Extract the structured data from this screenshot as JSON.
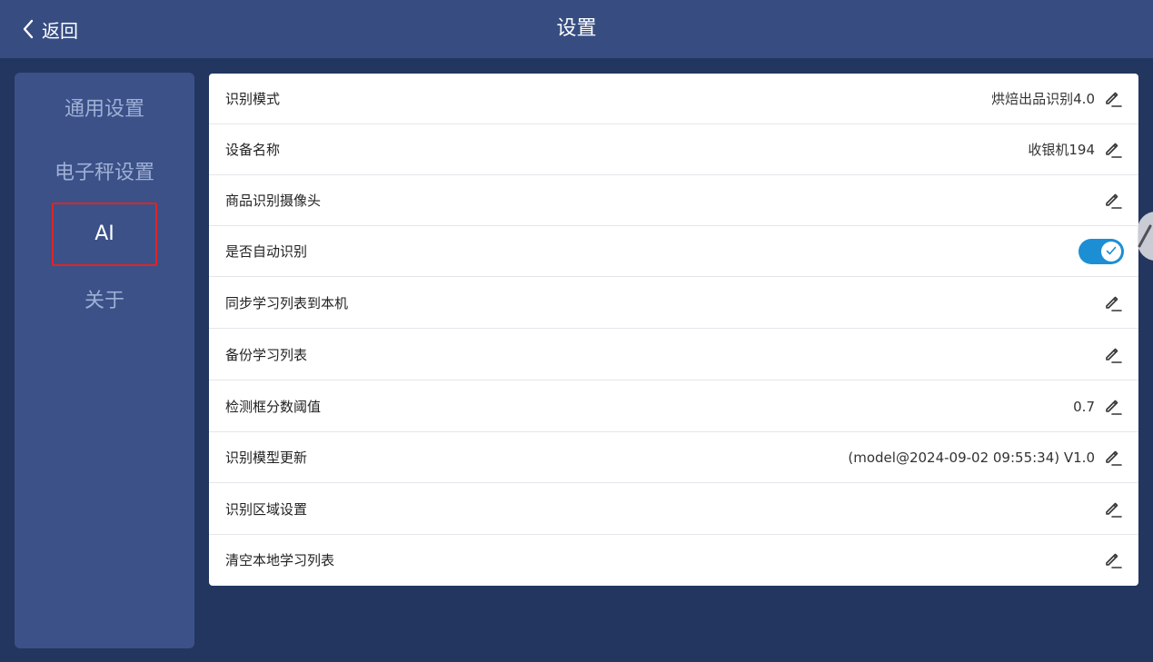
{
  "header": {
    "back_label": "返回",
    "title": "设置"
  },
  "sidebar": {
    "items": [
      {
        "label": "通用设置"
      },
      {
        "label": "电子秤设置"
      },
      {
        "label": "AI"
      },
      {
        "label": "关于"
      }
    ],
    "active_index": 2
  },
  "settings": {
    "rows": [
      {
        "label": "识别模式",
        "value": "烘焙出品识别4.0",
        "control": "edit"
      },
      {
        "label": "设备名称",
        "value": "收银机194",
        "control": "edit"
      },
      {
        "label": "商品识别摄像头",
        "value": "",
        "control": "edit"
      },
      {
        "label": "是否自动识别",
        "value": "",
        "control": "toggle",
        "toggle_on": true
      },
      {
        "label": "同步学习列表到本机",
        "value": "",
        "control": "edit"
      },
      {
        "label": "备份学习列表",
        "value": "",
        "control": "edit"
      },
      {
        "label": "检测框分数阈值",
        "value": "0.7",
        "control": "edit"
      },
      {
        "label": "识别模型更新",
        "value": "(model@2024-09-02 09:55:34) V1.0",
        "control": "edit"
      },
      {
        "label": "识别区域设置",
        "value": "",
        "control": "edit"
      },
      {
        "label": "清空本地学习列表",
        "value": "",
        "control": "edit"
      }
    ]
  },
  "icons": {
    "back": "chevron-left-icon",
    "edit": "pencil-icon",
    "toggle_check": "check-icon"
  },
  "colors": {
    "header_bg": "#374d82",
    "page_bg": "#233660",
    "sidebar_bg": "#3b5188",
    "active_highlight": "#e02424",
    "toggle_on": "#1c8fd4"
  }
}
